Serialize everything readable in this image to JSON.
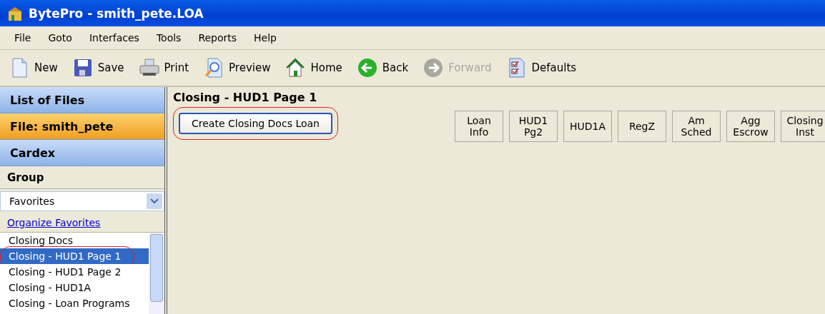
{
  "window": {
    "title": "BytePro - smith_pete.LOA"
  },
  "menu": [
    "File",
    "Goto",
    "Interfaces",
    "Tools",
    "Reports",
    "Help"
  ],
  "toolbar": [
    {
      "label": "New",
      "disabled": false
    },
    {
      "label": "Save",
      "disabled": false
    },
    {
      "label": "Print",
      "disabled": false
    },
    {
      "label": "Preview",
      "disabled": false
    },
    {
      "label": "Home",
      "disabled": false
    },
    {
      "label": "Back",
      "disabled": false
    },
    {
      "label": "Forward",
      "disabled": true
    },
    {
      "label": "Defaults",
      "disabled": false
    }
  ],
  "sidebar": {
    "nav": [
      {
        "label": "List of Files",
        "selected": false
      },
      {
        "label": "File: smith_pete",
        "selected": true
      },
      {
        "label": "Cardex",
        "selected": false
      }
    ],
    "group_label": "Group",
    "group_select": {
      "value": "Favorites"
    },
    "link": "Organize Favorites",
    "items": [
      {
        "label": "Closing Docs",
        "selected": false,
        "circled": false
      },
      {
        "label": "Closing - HUD1 Page 1",
        "selected": true,
        "circled": true
      },
      {
        "label": "Closing - HUD1 Page 2",
        "selected": false,
        "circled": false
      },
      {
        "label": "Closing - HUD1A",
        "selected": false,
        "circled": false
      },
      {
        "label": "Closing - Loan Programs",
        "selected": false,
        "circled": false
      }
    ]
  },
  "main": {
    "title": "Closing - HUD1 Page 1",
    "action_button": {
      "label": "Create Closing Docs Loan",
      "circled": true
    },
    "tabs": [
      [
        "Loan",
        "Info"
      ],
      [
        "HUD1",
        "Pg2"
      ],
      [
        "HUD1A"
      ],
      [
        "RegZ"
      ],
      [
        "Am",
        "Sched"
      ],
      [
        "Agg",
        "Escrow"
      ],
      [
        "Closing",
        "Inst"
      ]
    ]
  }
}
